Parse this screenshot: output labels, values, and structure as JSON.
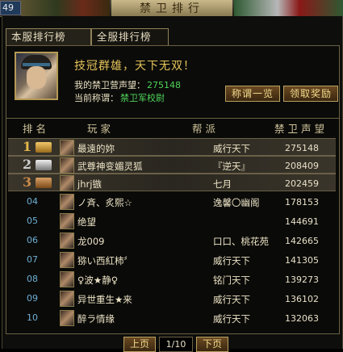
{
  "header": {
    "level": "49",
    "title": "禁卫排行"
  },
  "tabs": [
    {
      "label": "本服排行榜"
    },
    {
      "label": "全服排行榜"
    }
  ],
  "profile": {
    "slogan": "技冠群雄，天下无双！",
    "prestige_label": "我的禁卫营声望：",
    "prestige_value": "275148",
    "title_label": "当前称谓：",
    "title_value": "禁卫军校尉"
  },
  "buttons": {
    "titles": "称谓一览",
    "reward": "领取奖励"
  },
  "table": {
    "headers": [
      "排名",
      "玩家",
      "帮派",
      "禁卫声望"
    ],
    "rows": [
      {
        "rank": "1",
        "player": "最遠的妳",
        "guild": "威行天下",
        "score": "275148"
      },
      {
        "rank": "2",
        "player": "武尊神变媚灵狐",
        "guild": "『逆天』",
        "score": "208409"
      },
      {
        "rank": "3",
        "player": "jhrj镞",
        "guild": "七月",
        "score": "202459"
      },
      {
        "rank": "04",
        "player": "ノ斉、炙熙☆",
        "guild": "逸馨〇幽阁",
        "score": "178153"
      },
      {
        "rank": "05",
        "player": "绝望",
        "guild": "",
        "score": "144691"
      },
      {
        "rank": "06",
        "player": "龙009",
        "guild": "口口、桃花苑",
        "score": "142665"
      },
      {
        "rank": "07",
        "player": "猕い西紅柿〞",
        "guild": "威行天下",
        "score": "141305"
      },
      {
        "rank": "08",
        "player": "♀波★静♀",
        "guild": "铭门天下",
        "score": "139273"
      },
      {
        "rank": "09",
        "player": "异世重生★来",
        "guild": "威行天下",
        "score": "136102"
      },
      {
        "rank": "10",
        "player": "醉ラ情缘",
        "guild": "威行天下",
        "score": "132063"
      }
    ]
  },
  "pager": {
    "prev": "上页",
    "page": "1/10",
    "next": "下页"
  }
}
